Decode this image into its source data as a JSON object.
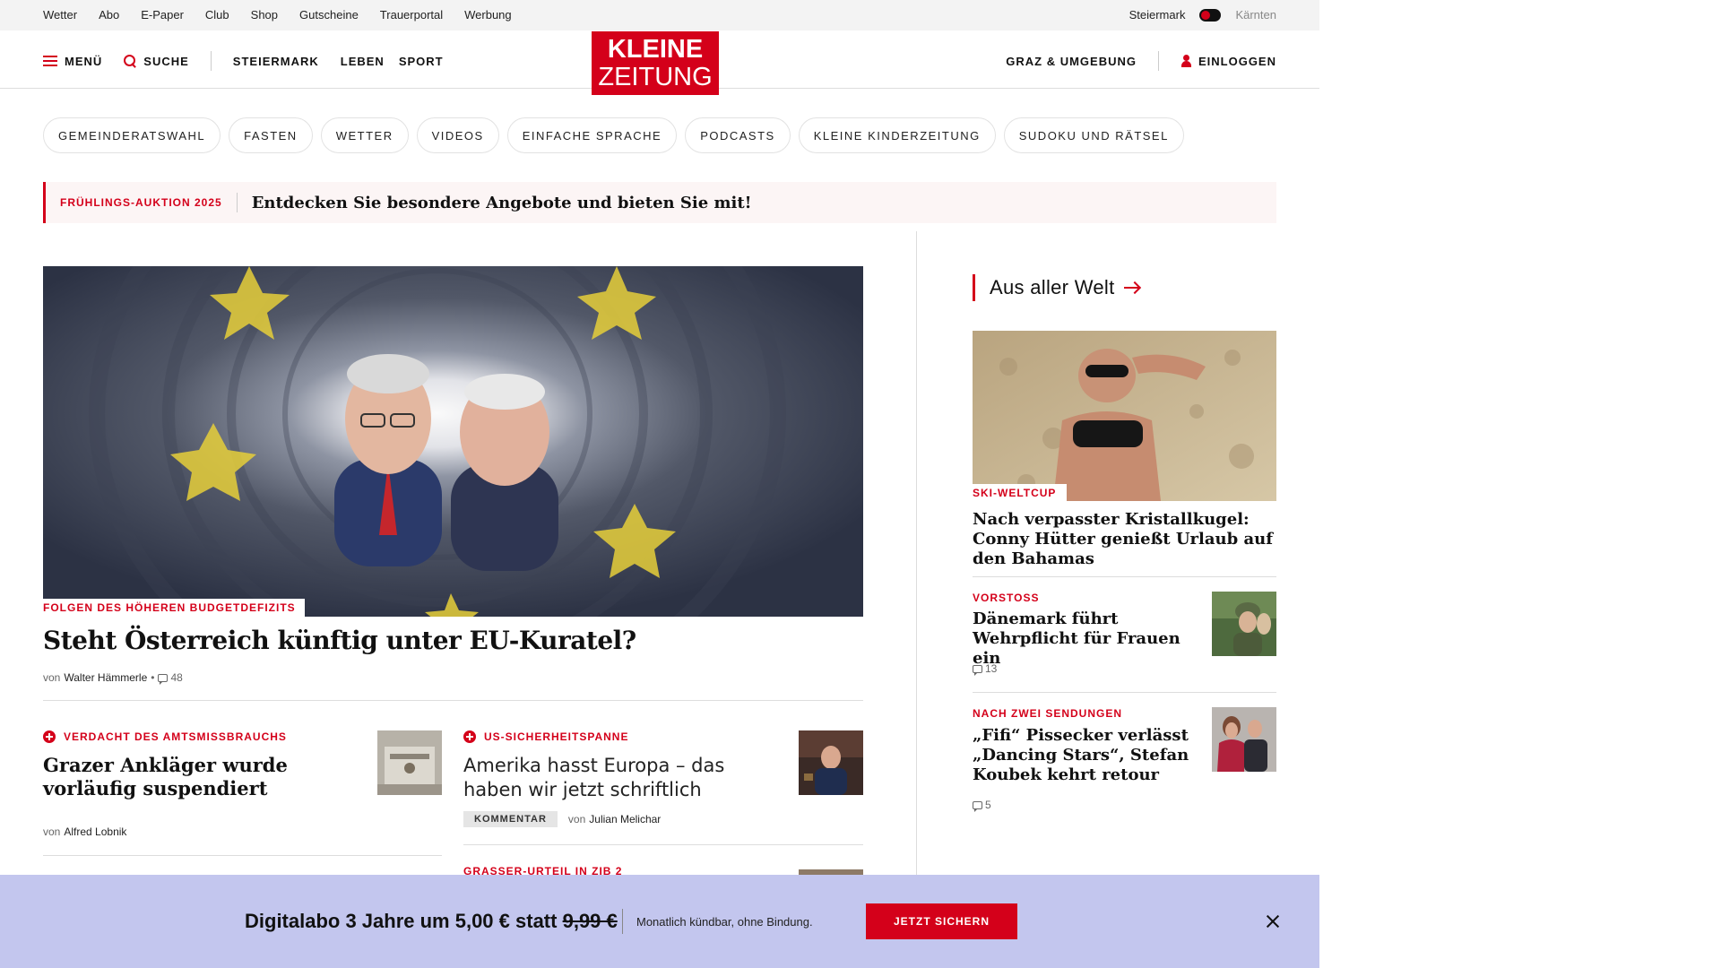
{
  "colors": {
    "brand_red": "#d4001a",
    "banner_bg": "#c3c6ee",
    "utility_bg": "#f3f3f3"
  },
  "utility_bar": {
    "links": [
      "Wetter",
      "Abo",
      "E-Paper",
      "Club",
      "Shop",
      "Gutscheine",
      "Trauerportal",
      "Werbung"
    ],
    "region_active": "Steiermark",
    "region_inactive": "Kärnten"
  },
  "header": {
    "menu_label": "MENÜ",
    "search_label": "SUCHE",
    "nav": [
      "STEIERMARK",
      "LEBEN",
      "SPORT"
    ],
    "logo_line1": "KLEINE",
    "logo_line2": "ZEITUNG",
    "region_link": "GRAZ & UMGEBUNG",
    "login_label": "EINLOGGEN"
  },
  "topics": [
    "GEMEINDERATSWAHL",
    "FASTEN",
    "WETTER",
    "VIDEOS",
    "EINFACHE SPRACHE",
    "PODCASTS",
    "KLEINE KINDERZEITUNG",
    "SUDOKU UND RÄTSEL"
  ],
  "promo": {
    "tag": "FRÜHLINGS-AUKTION 2025",
    "text": "Entdecken Sie besondere Angebote und bieten Sie mit!"
  },
  "hero": {
    "kicker": "FOLGEN DES HÖHEREN BUDGETDEFIZITS",
    "title": "Steht Österreich künftig unter EU-Kuratel?",
    "by": "von",
    "author": "Walter Hämmerle",
    "dot": "•",
    "comments": "48"
  },
  "articles": [
    {
      "kicker": "VERDACHT DES AMTSMISSBRAUCHS",
      "title": "Grazer Ankläger wurde vorläufig suspendiert",
      "by": "von",
      "author": "Alfred Lobnik"
    },
    {
      "kicker": "US-SICHERHEITSPANNE",
      "title": "Amerika hasst Europa – das haben wir jetzt schriftlich",
      "badge": "KOMMENTAR",
      "by": "von",
      "author": "Julian Melichar"
    },
    {
      "kicker": "GRASSER-URTEIL IN ZIB 2"
    }
  ],
  "sidebar": {
    "section_title": "Aus aller Welt",
    "feature": {
      "kicker": "SKI-WELTCUP",
      "title": "Nach verpasster Kristallkugel: Conny Hütter genießt Urlaub auf den Bahamas"
    },
    "items": [
      {
        "kicker": "VORSTOSS",
        "title": "Dänemark führt Wehrpflicht für Frauen ein",
        "comments": "13"
      },
      {
        "kicker": "NACH ZWEI SENDUNGEN",
        "title": "„Fifi“ Pissecker verlässt „Dancing Stars“, Stefan Koubek kehrt retour",
        "comments": "5"
      }
    ]
  },
  "banner": {
    "offer_main": "Digitalabo 3 Jahre um 5,00 € statt",
    "offer_old_price": "9,99 €",
    "note": "Monatlich kündbar, ohne Bindung.",
    "cta": "JETZT SICHERN"
  }
}
